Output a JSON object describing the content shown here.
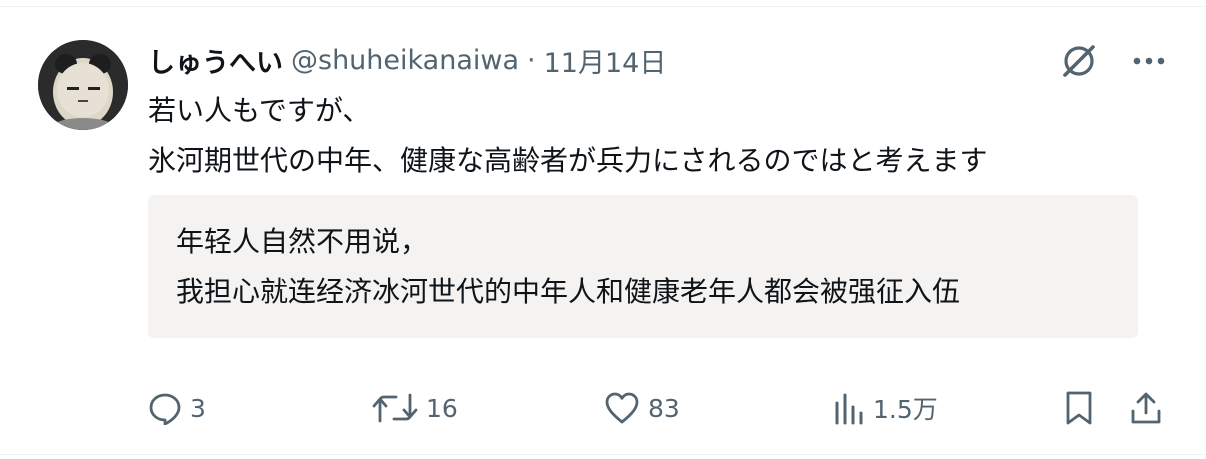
{
  "tweet": {
    "display_name": "しゅうへい",
    "handle": "@shuheikanaiwa",
    "separator": "·",
    "date": "11月14日",
    "text_lines": [
      "若い人もですが、",
      "氷河期世代の中年、健康な高齢者が兵力にされるのではと考えます"
    ],
    "translation_lines": [
      "年轻人自然不用说，",
      "我担心就连经济冰河世代的中年人和健康老年人都会被强征入伍"
    ]
  },
  "top_icons": {
    "grok": "grok-icon",
    "more": "more-icon"
  },
  "actions": {
    "reply": {
      "icon": "reply-icon",
      "count": "3"
    },
    "repost": {
      "icon": "repost-icon",
      "count": "16"
    },
    "like": {
      "icon": "heart-icon",
      "count": "83"
    },
    "views": {
      "icon": "views-icon",
      "count": "1.5万"
    },
    "bookmark": {
      "icon": "bookmark-icon"
    },
    "share": {
      "icon": "share-icon"
    }
  },
  "colors": {
    "text": "#0f1419",
    "secondary": "#536471",
    "translation_bg": "#f5f3f1",
    "border": "#eff3f4"
  }
}
